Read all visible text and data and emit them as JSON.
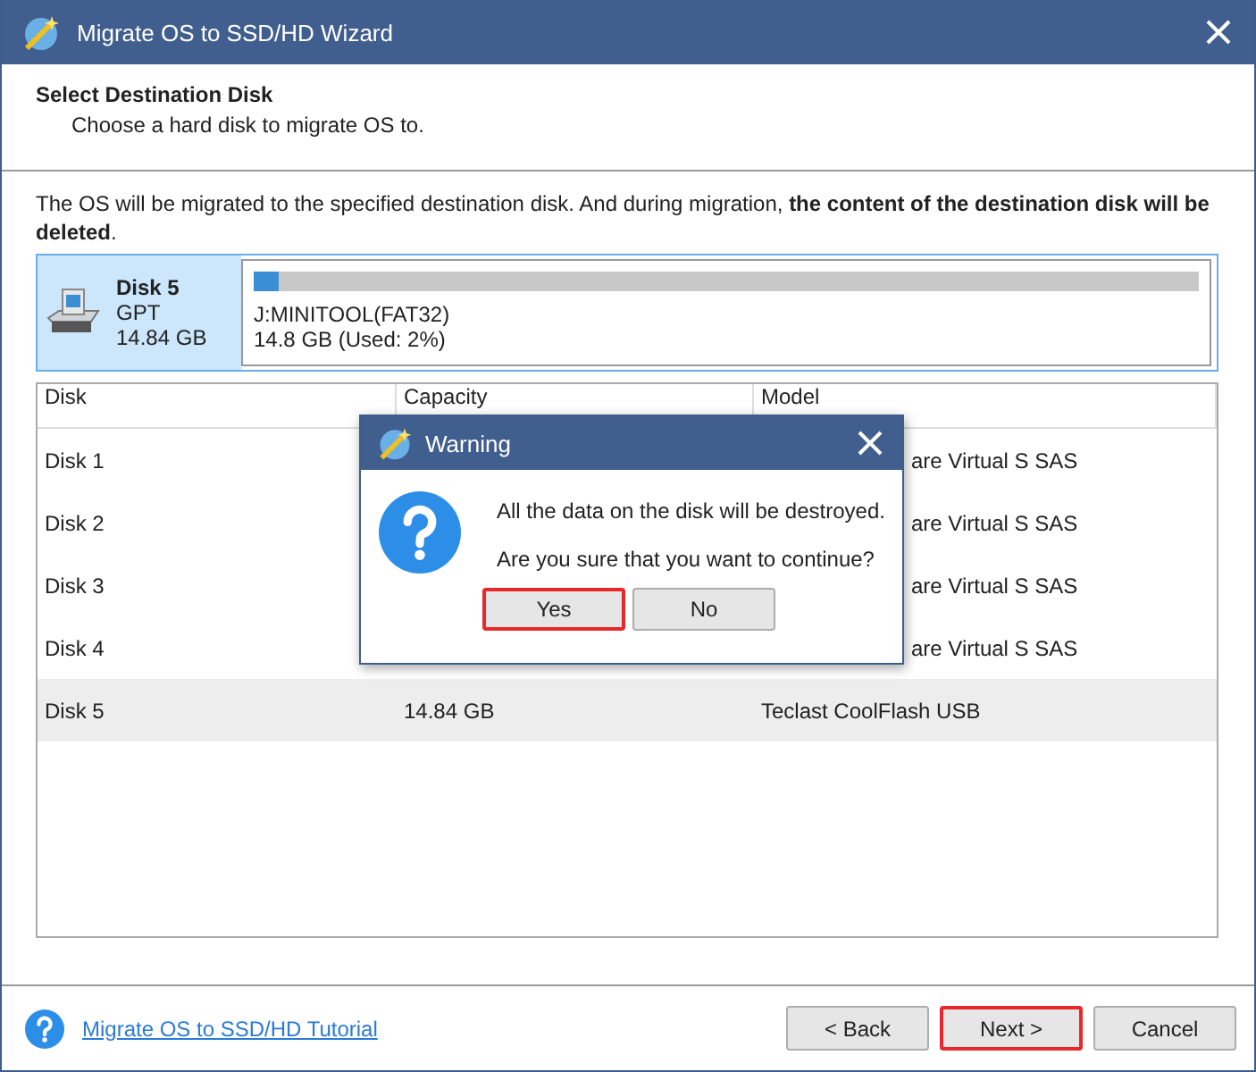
{
  "window": {
    "title": "Migrate OS to SSD/HD Wizard"
  },
  "header": {
    "title": "Select Destination Disk",
    "subtitle": "Choose a hard disk to migrate OS to."
  },
  "description": "The OS will be migrated to the specified destination disk. And during migration, **the content of the destination disk will be deleted**.",
  "selected_disk": {
    "name": "Disk 5",
    "style": "GPT",
    "size": "14.84 GB",
    "level": 0.02,
    "partition": "J:MINITOOL(FAT32)",
    "usage": "14.8 GB (Used: 2%)",
    "selected": true
  },
  "table": {
    "columns": [
      "Disk",
      "Capacity",
      "Model"
    ],
    "rows": [
      {
        "disk": "Disk 1",
        "model": "are Virtual S SAS",
        "selected": false
      },
      {
        "disk": "Disk 2",
        "model": "are Virtual S SAS",
        "selected": false
      },
      {
        "disk": "Disk 3",
        "model": "are Virtual S SAS",
        "selected": false
      },
      {
        "disk": "Disk 4",
        "model": "are Virtual S SAS",
        "selected": false
      },
      {
        "disk": "Disk 5",
        "capacity": "14.84 GB",
        "model": "Teclast CoolFlash USB",
        "selected": true
      }
    ]
  },
  "dialog": {
    "title": "Warning",
    "lines": [
      "All the data on the disk will be destroyed.",
      "Are you sure that you want to continue?"
    ],
    "buttons": [
      {
        "label": "Yes",
        "highlighted": true
      },
      {
        "label": "No",
        "highlighted": false
      }
    ]
  },
  "footer": {
    "link": "Migrate OS to SSD/HD Tutorial",
    "buttons": [
      {
        "label": "< Back",
        "highlighted": false
      },
      {
        "label": "Next >",
        "highlighted": true
      },
      {
        "label": "Cancel",
        "highlighted": false
      }
    ]
  }
}
